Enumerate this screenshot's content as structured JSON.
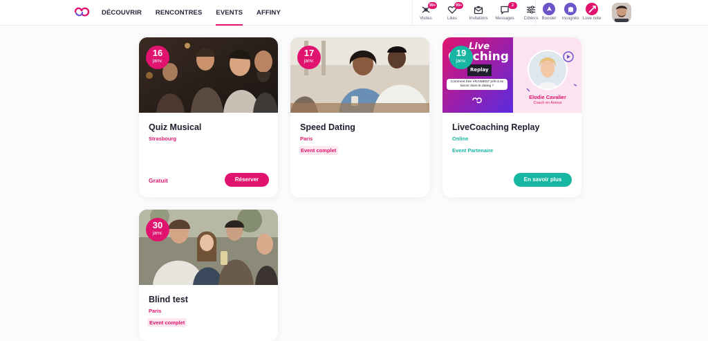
{
  "nav": {
    "items": [
      {
        "label": "DÉCOUVRIR",
        "active": false
      },
      {
        "label": "RENCONTRES",
        "active": false
      },
      {
        "label": "EVENTS",
        "active": true
      },
      {
        "label": "AFFINY",
        "active": false
      }
    ]
  },
  "actions": [
    {
      "label": "Visites",
      "badge": "99+",
      "icon": "visits-icon"
    },
    {
      "label": "Likes",
      "badge": "99+",
      "icon": "heart-icon"
    },
    {
      "label": "Invitations",
      "badge": "",
      "icon": "invitation-icon"
    },
    {
      "label": "Messages",
      "badge": "2",
      "icon": "message-icon"
    },
    {
      "label": "Critères",
      "badge": "",
      "icon": "sliders-icon"
    }
  ],
  "actions2": [
    {
      "label": "Booster",
      "icon": "booster-icon",
      "color": "#6b55c9"
    },
    {
      "label": "Incognito",
      "icon": "incognito-icon",
      "color": "#6b55c9"
    },
    {
      "label": "Love note",
      "icon": "love-note-icon",
      "color": "#e0136e"
    }
  ],
  "colors": {
    "brand": "#e0136e",
    "teal": "#16b6a3",
    "violet": "#6b55c9"
  },
  "events": [
    {
      "day": "16",
      "month": "janv.",
      "title": "Quiz Musical",
      "city": "Strasbourg",
      "tag": "",
      "price": "Gratuit",
      "button": "Réserver"
    },
    {
      "day": "17",
      "month": "janv.",
      "title": "Speed Dating",
      "city": "Paris",
      "tag": "Event complet",
      "price": "",
      "button": ""
    },
    {
      "day": "19",
      "month": "janv.",
      "title": "LiveCoaching Replay",
      "city": "Online",
      "tag": "Event Partenaire",
      "price": "",
      "button": "En savoir plus",
      "promo": {
        "headline_1": "Live",
        "headline_2": "Coaching",
        "headline_3": "Replay",
        "question": "Comment être VRAIMENT prêt à se lancer dans le dating ?",
        "speaker": "Elodie Cavalier",
        "role": "Coach en Amour"
      }
    },
    {
      "day": "30",
      "month": "janv.",
      "title": "Blind test",
      "city": "Paris",
      "tag": "Event complet",
      "price": "",
      "button": ""
    }
  ]
}
